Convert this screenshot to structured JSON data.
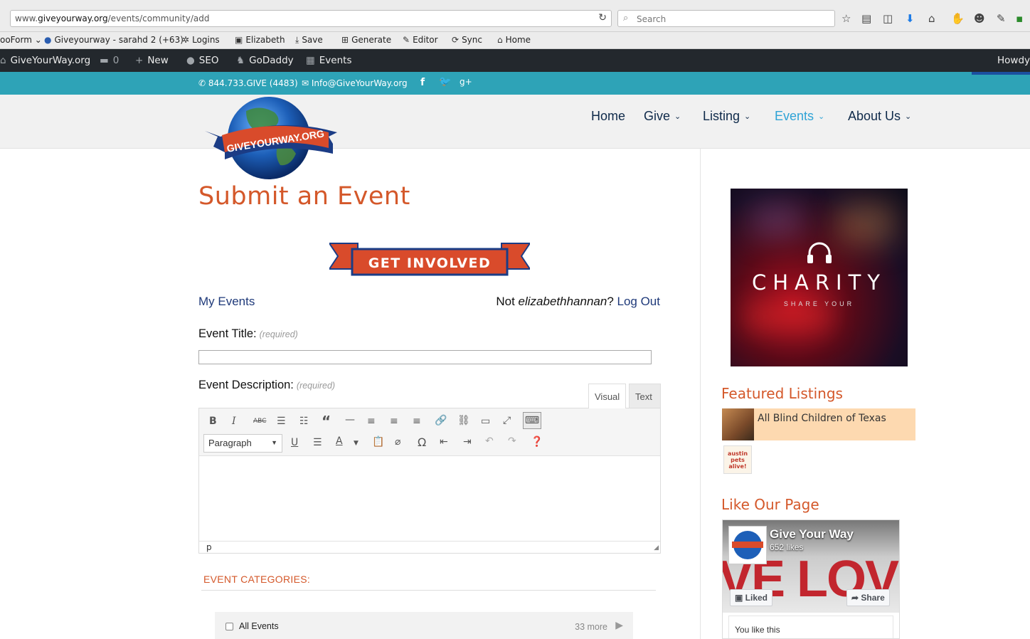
{
  "browser": {
    "url_prefix": "www.",
    "url_domain": "giveyourway.org",
    "url_path": "/events/community/add",
    "search_placeholder": "Search",
    "bookmarks": [
      {
        "label": "ooForm ⌄",
        "icon": ""
      },
      {
        "label": "Giveyourway - sarahd 2 (+63)",
        "icon": "globe-icon"
      },
      {
        "label": "Logins",
        "icon": "sparkle-icon"
      },
      {
        "label": "Elizabeth",
        "icon": "document-icon"
      },
      {
        "label": "Save",
        "icon": "download-icon"
      },
      {
        "label": "Generate",
        "icon": "grid-icon"
      },
      {
        "label": "Editor",
        "icon": "edit-icon"
      },
      {
        "label": "Sync",
        "icon": "sync-icon"
      },
      {
        "label": "Home",
        "icon": "home-icon"
      }
    ]
  },
  "adminbar": {
    "site": "GiveYourWay.org",
    "comments": "0",
    "new": "New",
    "seo": "SEO",
    "godaddy": "GoDaddy",
    "events": "Events",
    "howdy": "Howdy,"
  },
  "topbar": {
    "phone": "844.733.GIVE (4483)",
    "email": "Info@GiveYourWay.org"
  },
  "nav": {
    "items": [
      "Home",
      "Give",
      "Listing",
      "Events",
      "About Us"
    ],
    "active": "Events"
  },
  "logo": {
    "text": "GIVEYOURWAY.ORG"
  },
  "page": {
    "title": "Submit an Event",
    "banner": "GET INVOLVED",
    "my_events": "My Events",
    "not_prefix": "Not ",
    "username": "elizabethhannan",
    "not_suffix": "? ",
    "logout": "Log Out",
    "event_title_label": "Event Title:",
    "event_desc_label": "Event Description:",
    "required": "(required)",
    "tab_visual": "Visual",
    "tab_text": "Text",
    "format_select": "Paragraph",
    "status_path": "p",
    "categories_heading": "EVENT CATEGORIES:",
    "category_label": "All Events",
    "category_more": "33 more"
  },
  "sidebar": {
    "charity_word": "CHARITY",
    "charity_sub": "SHARE YOUR",
    "featured_heading": "Featured Listings",
    "featured_item": "All Blind Children of Texas",
    "featured_item2_logo": "austin pets alive!",
    "like_heading": "Like Our Page",
    "fb_name": "Give Your Way",
    "fb_likes": "652 likes",
    "fb_cover_word": "VE LOV",
    "fb_liked": "Liked",
    "fb_share": "Share",
    "fb_you_like": "You like this"
  }
}
